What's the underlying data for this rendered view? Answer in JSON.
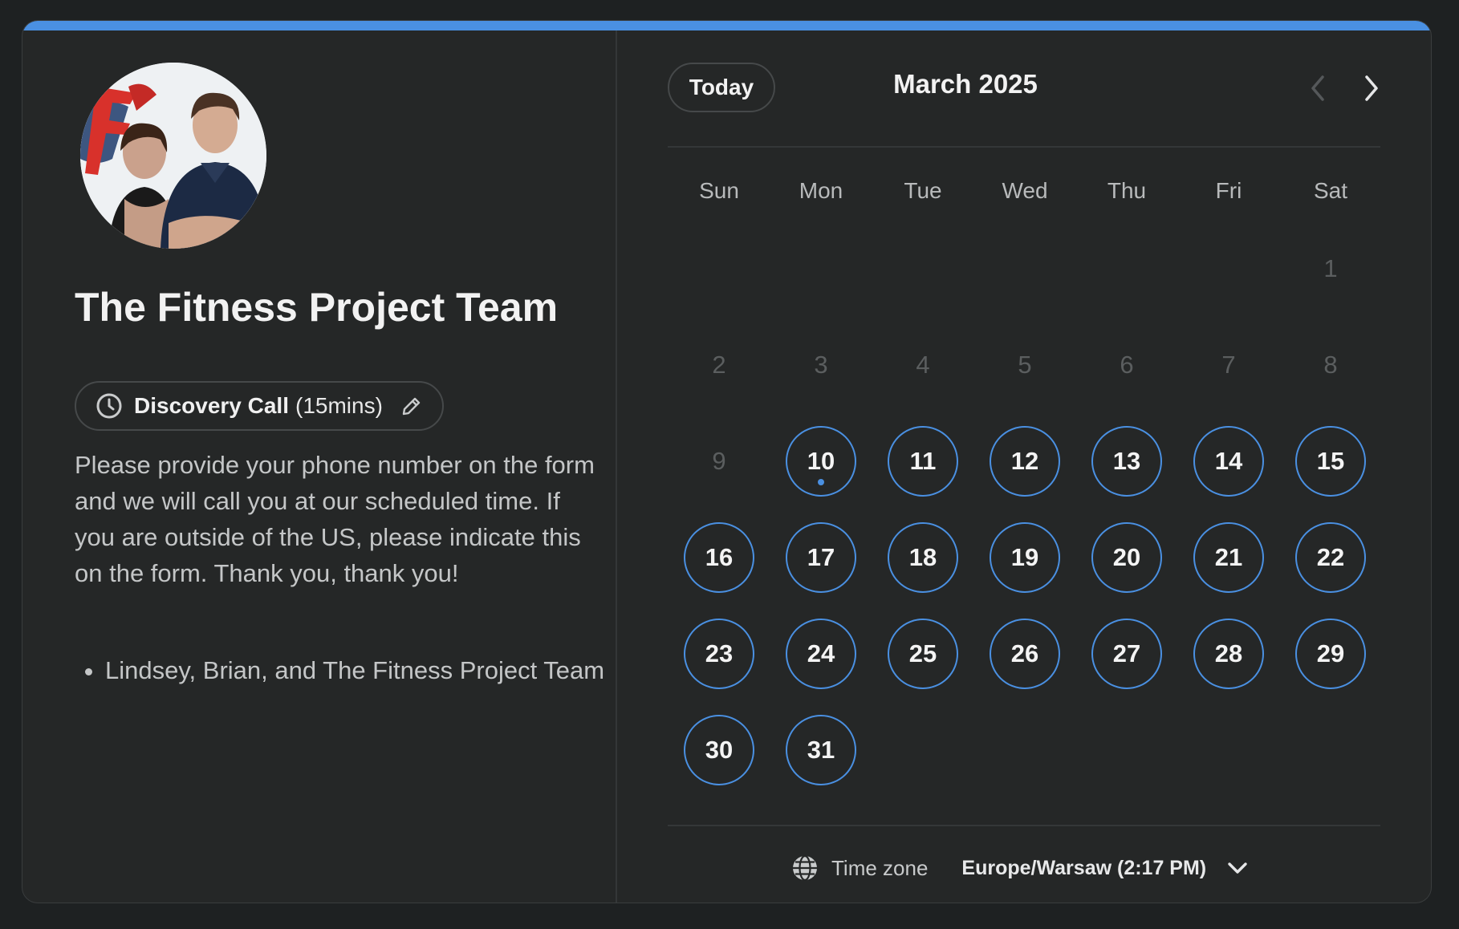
{
  "profile": {
    "title": "The Fitness Project Team",
    "avatar_icon": "team-photo"
  },
  "event": {
    "name": "Discovery Call",
    "duration": "(15mins)",
    "icon": "clock-icon",
    "edit_icon": "pencil-icon"
  },
  "description": "Please provide your phone number on the form and we will call you at our scheduled time. If you are outside of the US, please indicate this on the form. Thank you, thank you!",
  "bullets": [
    "Lindsey, Brian, and The Fitness Project Team"
  ],
  "calendar": {
    "today_label": "Today",
    "month_title": "March 2025",
    "weekdays": [
      "Sun",
      "Mon",
      "Tue",
      "Wed",
      "Thu",
      "Fri",
      "Sat"
    ],
    "first_weekday_index": 6,
    "days_in_month": 31,
    "first_available_day": 10,
    "today_marker_day": 10
  },
  "timezone": {
    "label": "Time zone",
    "value": "Europe/Warsaw (2:17 PM)"
  },
  "colors": {
    "accent": "#4a90e2",
    "background": "#252727",
    "page": "#1e2122"
  }
}
